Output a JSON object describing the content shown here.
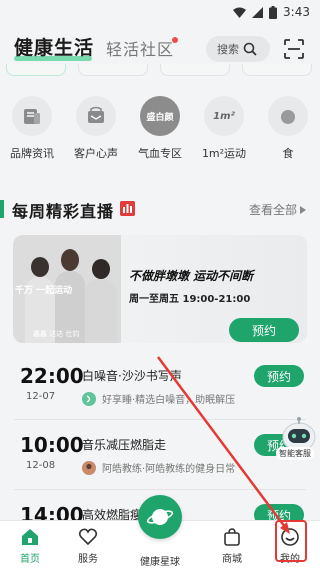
{
  "status_bar": {
    "time": "3:43"
  },
  "header": {
    "title": "健康生活",
    "tab_social": "轻活社区",
    "search_placeholder": "搜索"
  },
  "categories": [
    {
      "label": "品牌资讯",
      "icon": "brand-news-icon",
      "logo_text": ""
    },
    {
      "label": "客户心声",
      "icon": "customer-voice-icon",
      "logo_text": ""
    },
    {
      "label": "气血专区",
      "icon": "qixue-icon",
      "logo_text": "盛白颜"
    },
    {
      "label": "1m²运动",
      "icon": "sport-icon",
      "logo_text": "1m²"
    },
    {
      "label": "食",
      "icon": "food-icon",
      "logo_text": ""
    }
  ],
  "live_section": {
    "title": "每周精彩直播",
    "see_all": "查看全部"
  },
  "banner": {
    "title": "不做胖墩墩 运动不间断",
    "subtitle": "周一至周五 19:00-21:00",
    "button": "预约",
    "photo_caption": "千万 一起运动",
    "photo_names": "鑫鑫 达达 仕钧"
  },
  "schedule": [
    {
      "time": "22:00",
      "date": "12-07",
      "title": "白噪音·沙沙书写声",
      "sub": "好享睡·精选白噪音，助眠解压",
      "button": "预约"
    },
    {
      "time": "10:00",
      "date": "12-08",
      "title": "音乐减压燃脂走",
      "sub": "阿皓教练·阿皓教练的健身日常",
      "button": "预约"
    },
    {
      "time": "14:00",
      "date": "",
      "title": "高效燃脂瘦全身",
      "sub": "",
      "button": "预约"
    }
  ],
  "assistant": {
    "label": "智能客服"
  },
  "bottom_nav": {
    "home": "首页",
    "service": "服务",
    "planet": "健康星球",
    "mall": "商城",
    "mine": "我的"
  },
  "colors": {
    "accent": "#1fa46c",
    "annotation_arrow": "#e53935"
  }
}
